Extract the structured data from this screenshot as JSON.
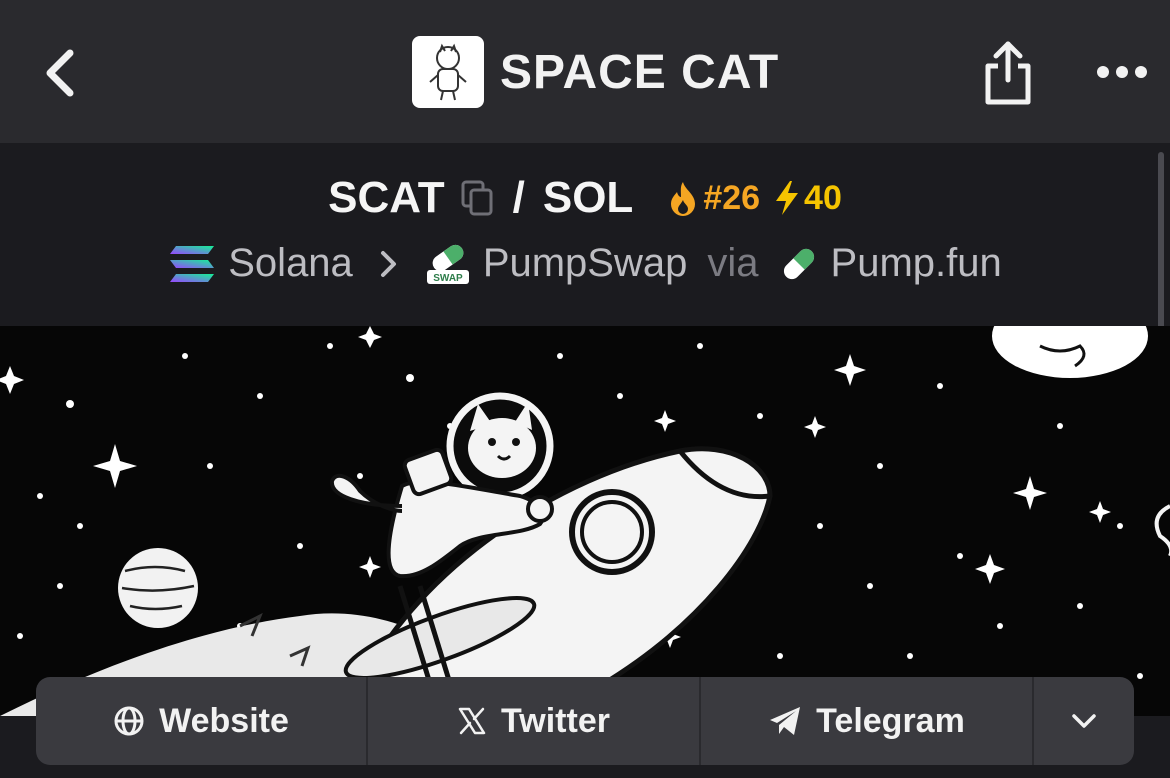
{
  "header": {
    "title": "SPACE CAT",
    "back_icon": "chevron-left-icon",
    "share_icon": "share-icon",
    "more_icon": "ellipsis-icon"
  },
  "pair": {
    "base": "SCAT",
    "separator": "/",
    "quote": "SOL",
    "trending_rank": "#26",
    "boost_count": "40",
    "colors": {
      "trending": "#f5a623",
      "boost": "#f5c400"
    }
  },
  "path": {
    "chain": "Solana",
    "dex": "PumpSwap",
    "via_label": "via",
    "launchpad": "Pump.fun",
    "dex_icon_text": "SWAP"
  },
  "links": [
    {
      "label": "Website",
      "icon": "globe-icon"
    },
    {
      "label": "Twitter",
      "icon": "x-icon"
    },
    {
      "label": "Telegram",
      "icon": "telegram-icon"
    },
    {
      "label": "",
      "icon": "chevron-down-icon"
    }
  ]
}
